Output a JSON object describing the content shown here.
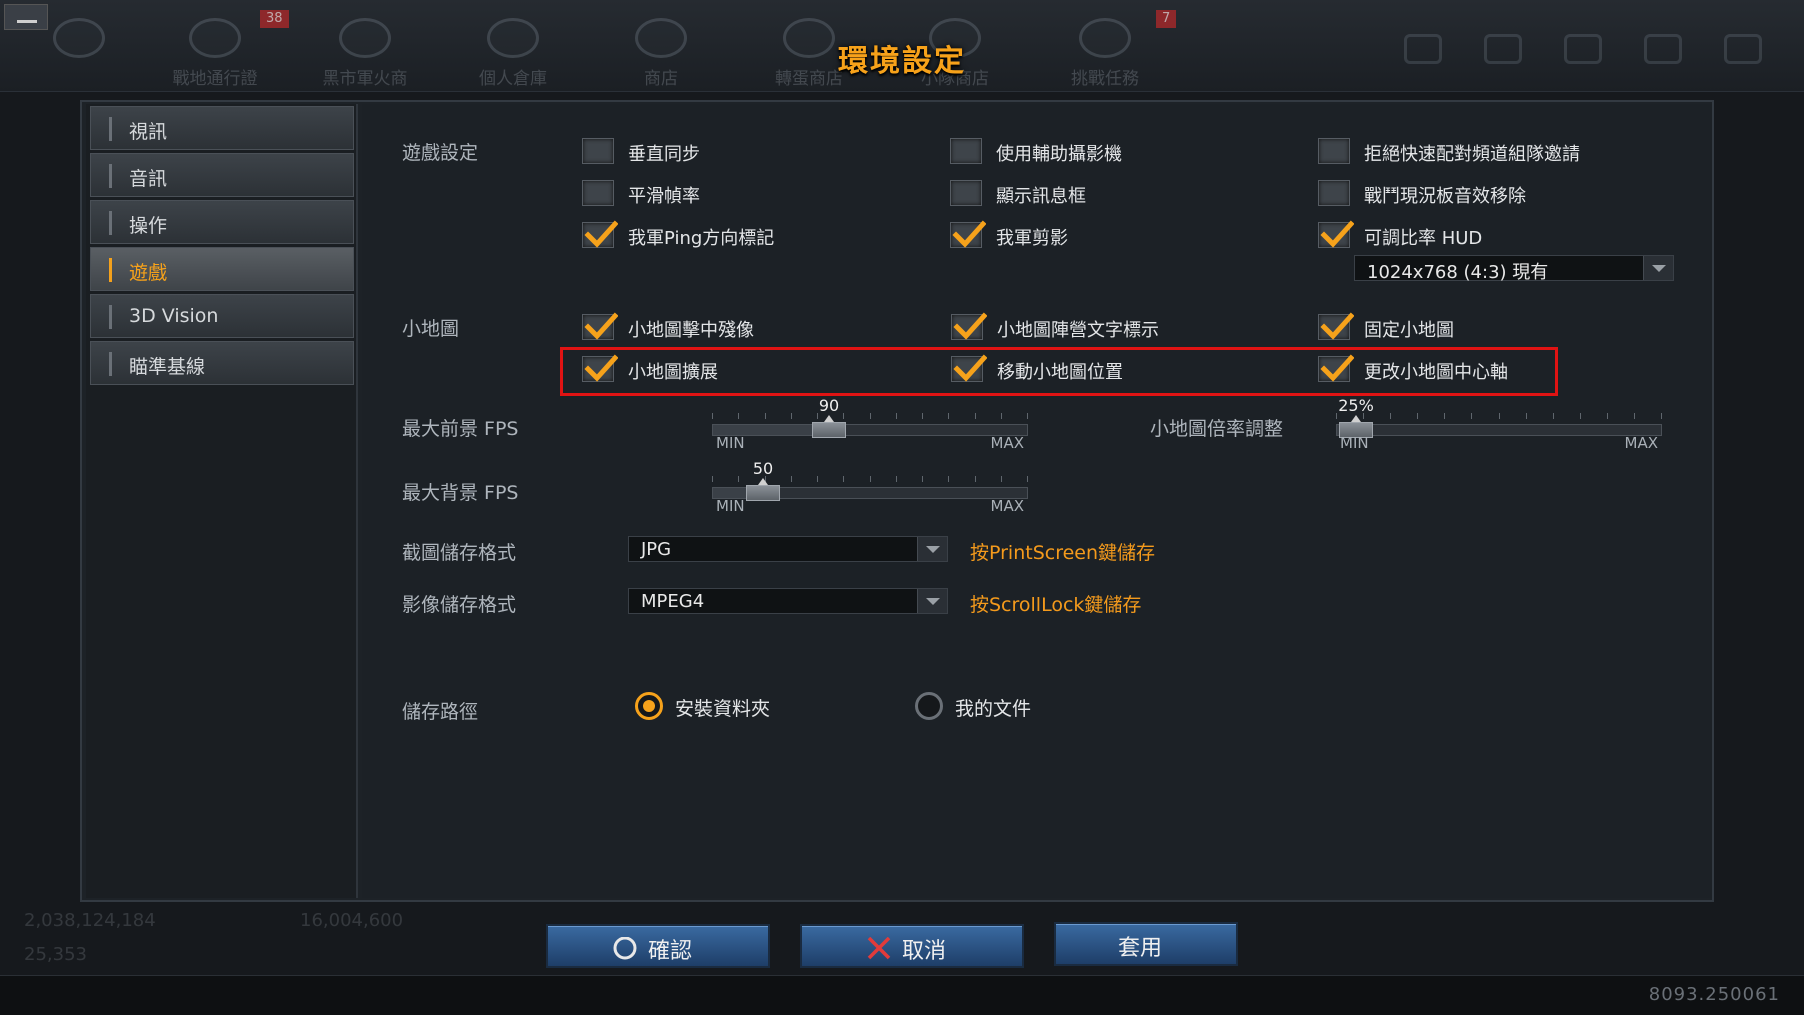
{
  "dialog_title": "環境設定",
  "background": {
    "nav": [
      {
        "label": "戰地通行證",
        "icon": "battle-pass-icon"
      },
      {
        "label": "黑市軍火商",
        "icon": "black-market-icon"
      },
      {
        "label": "個人倉庫",
        "icon": "inventory-icon"
      },
      {
        "label": "商店",
        "icon": "shop-icon"
      },
      {
        "label": "轉蛋商店",
        "icon": "gacha-icon"
      },
      {
        "label": "小隊商店",
        "icon": "squad-shop-icon"
      },
      {
        "label": "挑戰任務",
        "icon": "challenge-icon"
      }
    ],
    "badges": [
      "38",
      "7"
    ],
    "stats": [
      "2,038,124,184",
      "16,004,600",
      "25,353"
    ],
    "version": "8093.250061"
  },
  "sidebar": {
    "items": [
      {
        "label": "視訊",
        "active": false
      },
      {
        "label": "音訊",
        "active": false
      },
      {
        "label": "操作",
        "active": false
      },
      {
        "label": "遊戲",
        "active": true
      },
      {
        "label": "3D Vision",
        "active": false
      },
      {
        "label": "瞄準基線",
        "active": false
      }
    ]
  },
  "game_settings": {
    "label": "遊戲設定",
    "checkboxes": [
      {
        "label": "垂直同步",
        "checked": false
      },
      {
        "label": "使用輔助攝影機",
        "checked": false
      },
      {
        "label": "拒絕快速配對頻道組隊邀請",
        "checked": false
      },
      {
        "label": "平滑幀率",
        "checked": false
      },
      {
        "label": "顯示訊息框",
        "checked": false
      },
      {
        "label": "戰鬥現況板音效移除",
        "checked": false
      },
      {
        "label": "我軍Ping方向標記",
        "checked": true
      },
      {
        "label": "我軍剪影",
        "checked": true
      },
      {
        "label": "可調比率 HUD",
        "checked": true
      }
    ],
    "hud_resolution": "1024x768 (4:3) 現有"
  },
  "minimap": {
    "label": "小地圖",
    "checkboxes": [
      {
        "label": "小地圖擊中殘像",
        "checked": true
      },
      {
        "label": "小地圖陣營文字標示",
        "checked": true
      },
      {
        "label": "固定小地圖",
        "checked": true
      },
      {
        "label": "小地圖擴展",
        "checked": true
      },
      {
        "label": "移動小地圖位置",
        "checked": true
      },
      {
        "label": "更改小地圖中心軸",
        "checked": true
      }
    ]
  },
  "sliders": {
    "min_label": "MIN",
    "max_label": "MAX",
    "fg_fps": {
      "label": "最大前景 FPS",
      "value": "90",
      "fraction": 0.37
    },
    "bg_fps": {
      "label": "最大背景 FPS",
      "value": "50",
      "fraction": 0.16
    },
    "minimap_scale": {
      "label": "小地圖倍率調整",
      "value": "25%",
      "fraction": 0.06
    }
  },
  "capture": {
    "screenshot_label": "截圖儲存格式",
    "screenshot_format": "JPG",
    "screenshot_hint": "按PrintScreen鍵儲存",
    "video_label": "影像儲存格式",
    "video_format": "MPEG4",
    "video_hint": "按ScrollLock鍵儲存"
  },
  "save_path": {
    "label": "儲存路徑",
    "options": [
      {
        "label": "安裝資料夾",
        "selected": true
      },
      {
        "label": "我的文件",
        "selected": false
      }
    ]
  },
  "buttons": {
    "confirm": "確認",
    "cancel": "取消",
    "apply": "套用"
  },
  "colors": {
    "accent": "#f7a21a",
    "highlight": "#e01313",
    "button": "#2c5488"
  }
}
